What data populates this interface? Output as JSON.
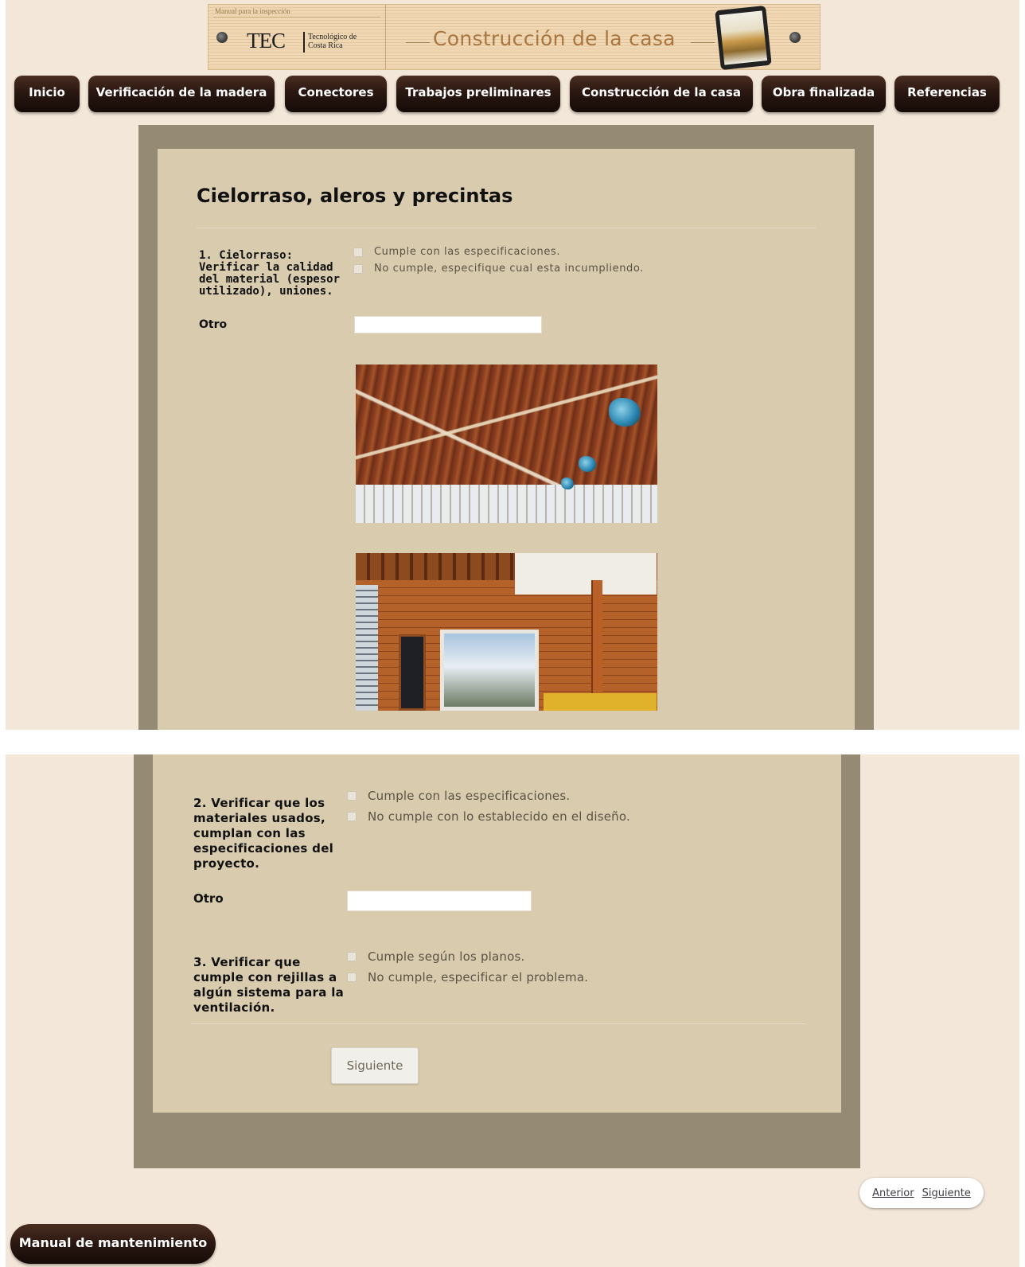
{
  "banner": {
    "tagline": "Manual para la inspección",
    "logo": "TEC",
    "logo_sub": "Tecnológico de Costa Rica",
    "title": "Construcción de la casa",
    "tablet_icon": "tablet-icon",
    "bolt_icon": "bolt-icon"
  },
  "nav": [
    {
      "label": "Inicio"
    },
    {
      "label": "Verificación de la madera"
    },
    {
      "label": "Conectores"
    },
    {
      "label": "Trabajos preliminares"
    },
    {
      "label": "Construcción de la casa"
    },
    {
      "label": "Obra finalizada"
    },
    {
      "label": "Referencias"
    }
  ],
  "form": {
    "title": "Cielorraso, aleros y precintas",
    "q1": {
      "label": "1. Cielorraso: Verificar la calidad del material (espesor utilizado), uniones.",
      "options": [
        "Cumple con las especificaciones.",
        "No cumple, especifique cual esta incumpliendo."
      ],
      "otro_label": "Otro",
      "otro_value": ""
    },
    "q2": {
      "label": "2. Verificar que los materiales usados, cumplan con las especificaciones del proyecto.",
      "options": [
        "Cumple con las especificaciones.",
        "No cumple con lo establecido en el diseño."
      ],
      "otro_label": "Otro",
      "otro_value": ""
    },
    "q3": {
      "label": "3. Verificar que cumple con rejillas a algún sistema para la ventilación.",
      "options": [
        "Cumple según los planos.",
        "No cumple, especificar el problema."
      ]
    },
    "next_button": "Siguiente"
  },
  "pager": {
    "prev": "Anterior",
    "next": "Siguiente"
  },
  "manual_button": "Manual de mantenimiento",
  "colors": {
    "page_bg": "#f3e7d9",
    "frame": "#958b75",
    "panel": "#d8cbae",
    "nav_button": "#2a1711",
    "banner_title": "#a9763f"
  }
}
